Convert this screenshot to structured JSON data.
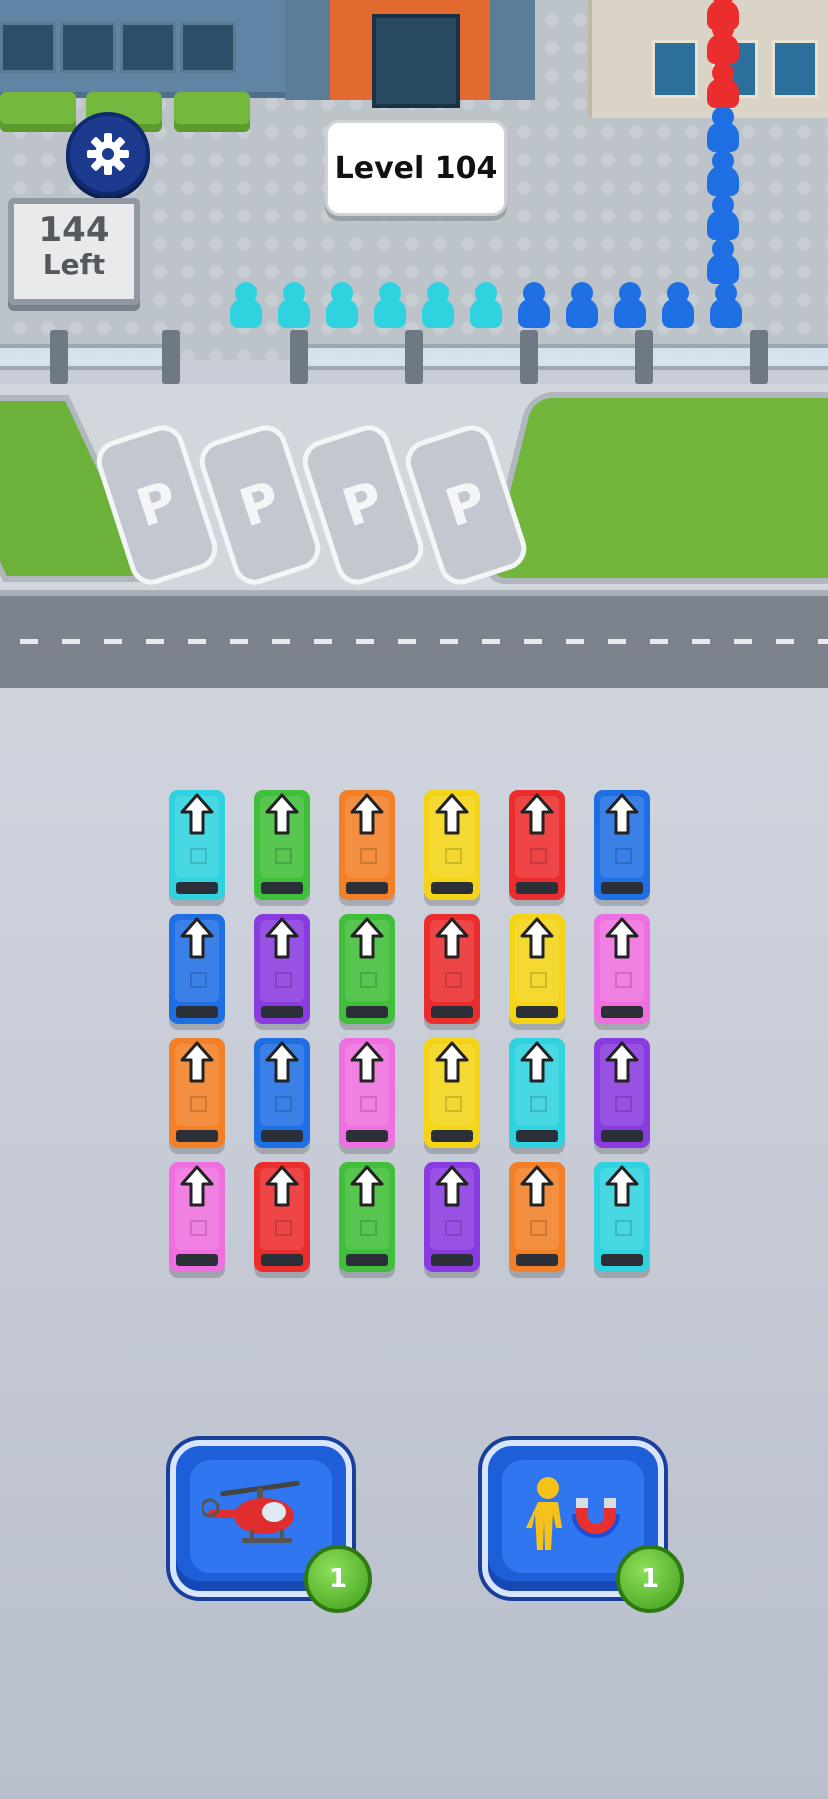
{
  "hud": {
    "level_label": "Level 104",
    "remaining_count": "144",
    "remaining_label": "Left",
    "settings_icon": "gear-icon"
  },
  "queue": {
    "waiting_passengers": [
      "cyan",
      "cyan",
      "cyan",
      "cyan",
      "cyan",
      "cyan",
      "blue",
      "blue",
      "blue",
      "blue",
      "blue",
      "blue",
      "blue",
      "blue",
      "blue",
      "red",
      "red",
      "red"
    ]
  },
  "parking": {
    "spots": [
      "P",
      "P",
      "P",
      "P"
    ]
  },
  "bus_grid": {
    "rows": [
      [
        "cyan",
        "green",
        "orange",
        "yellow",
        "red",
        "blue"
      ],
      [
        "blue",
        "purple",
        "green",
        "red",
        "yellow",
        "pink"
      ],
      [
        "orange",
        "blue",
        "pink",
        "yellow",
        "cyan",
        "purple"
      ],
      [
        "pink",
        "red",
        "green",
        "purple",
        "orange",
        "cyan"
      ]
    ],
    "direction": "up"
  },
  "powerups": [
    {
      "name": "helicopter",
      "icon": "helicopter-icon",
      "count": "1"
    },
    {
      "name": "magnet",
      "icon": "magnet-icon",
      "count": "1"
    }
  ],
  "colors": {
    "cyan": "#2fd3e0",
    "green": "#3fbf3a",
    "orange": "#f37f26",
    "yellow": "#f4d417",
    "red": "#ec2d2d",
    "blue": "#1f6fe4",
    "purple": "#8a3be0",
    "pink": "#ef6fe0"
  }
}
